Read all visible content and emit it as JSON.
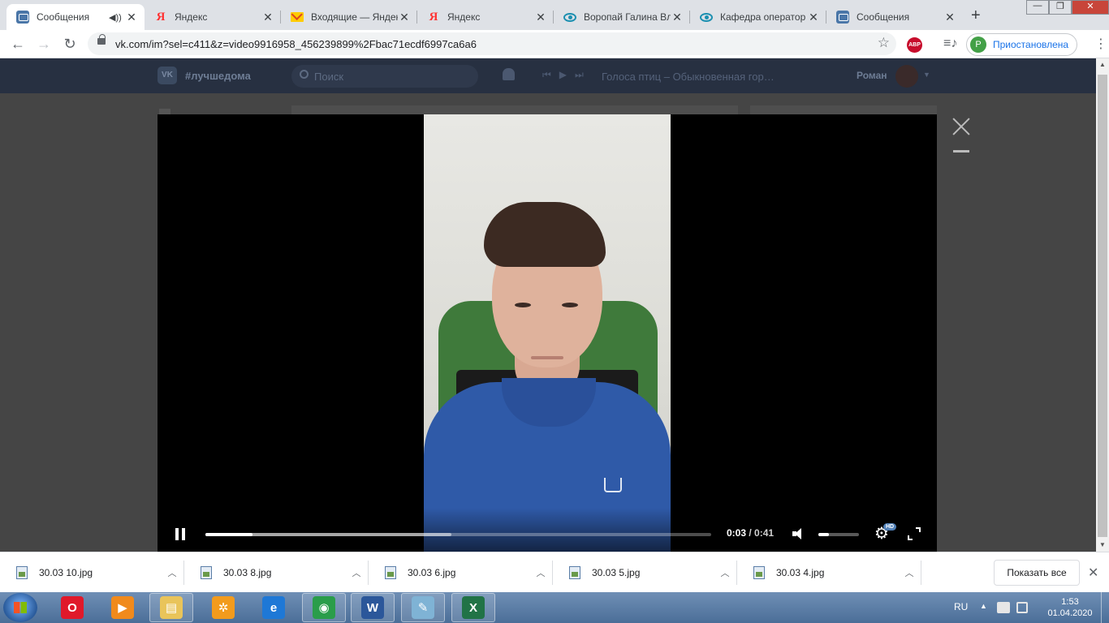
{
  "browser": {
    "tabs": [
      {
        "title": "Сообщения",
        "icon": "vk-icon",
        "active": true,
        "audio": true
      },
      {
        "title": "Яндекс",
        "icon": "yandex-icon"
      },
      {
        "title": "Входящие — Яндек",
        "icon": "mail-icon"
      },
      {
        "title": "Яндекс",
        "icon": "yandex-icon"
      },
      {
        "title": "Воропай Галина Вл",
        "icon": "eye-icon"
      },
      {
        "title": "Кафедра оператор",
        "icon": "eye-icon"
      },
      {
        "title": "Сообщения",
        "icon": "vk-icon"
      }
    ],
    "url": "vk.com/im?sel=c411&z=video9916958_456239899%2Fbac71ecdf6997ca6a6",
    "profile": {
      "initial": "P",
      "status": "Приостановлена",
      "color": "#43a047"
    },
    "adblock_label": "ABP"
  },
  "vk": {
    "tag": "#лучшедома",
    "search_placeholder": "Поиск",
    "song": "Голоса птиц – Обыкновенная гор…",
    "user": "Роман",
    "accent": "#4a76a8"
  },
  "player": {
    "current_time": "0:03",
    "separator": " / ",
    "duration": "0:41",
    "hd_badge": "HD",
    "progress_fraction": 0.0935,
    "buffered_fraction": 0.487,
    "volume_fraction": 0.25
  },
  "downloads": {
    "items": [
      "30.03 10.jpg",
      "30.03 8.jpg",
      "30.03 6.jpg",
      "30.03 5.jpg",
      "30.03 4.jpg"
    ],
    "show_all": "Показать все"
  },
  "taskbar": {
    "apps": [
      {
        "name": "opera-icon",
        "glyph": "O",
        "color": "#e0192a"
      },
      {
        "name": "media-player-icon",
        "glyph": "▶",
        "color": "#f08a1c"
      },
      {
        "name": "explorer-icon",
        "glyph": "▤",
        "color": "#e9c45a"
      },
      {
        "name": "settings-app-icon",
        "glyph": "✲",
        "color": "#f29b1d"
      },
      {
        "name": "internet-explorer-icon",
        "glyph": "e",
        "color": "#1e78d6"
      },
      {
        "name": "chrome-icon",
        "glyph": "◉",
        "color": "#2a9d4a"
      },
      {
        "name": "word-icon",
        "glyph": "W",
        "color": "#2b579a"
      },
      {
        "name": "paint-icon",
        "glyph": "✎",
        "color": "#7fb3d5"
      },
      {
        "name": "excel-icon",
        "glyph": "X",
        "color": "#217346"
      }
    ],
    "language": "RU",
    "time": "1:53",
    "date": "01.04.2020"
  }
}
